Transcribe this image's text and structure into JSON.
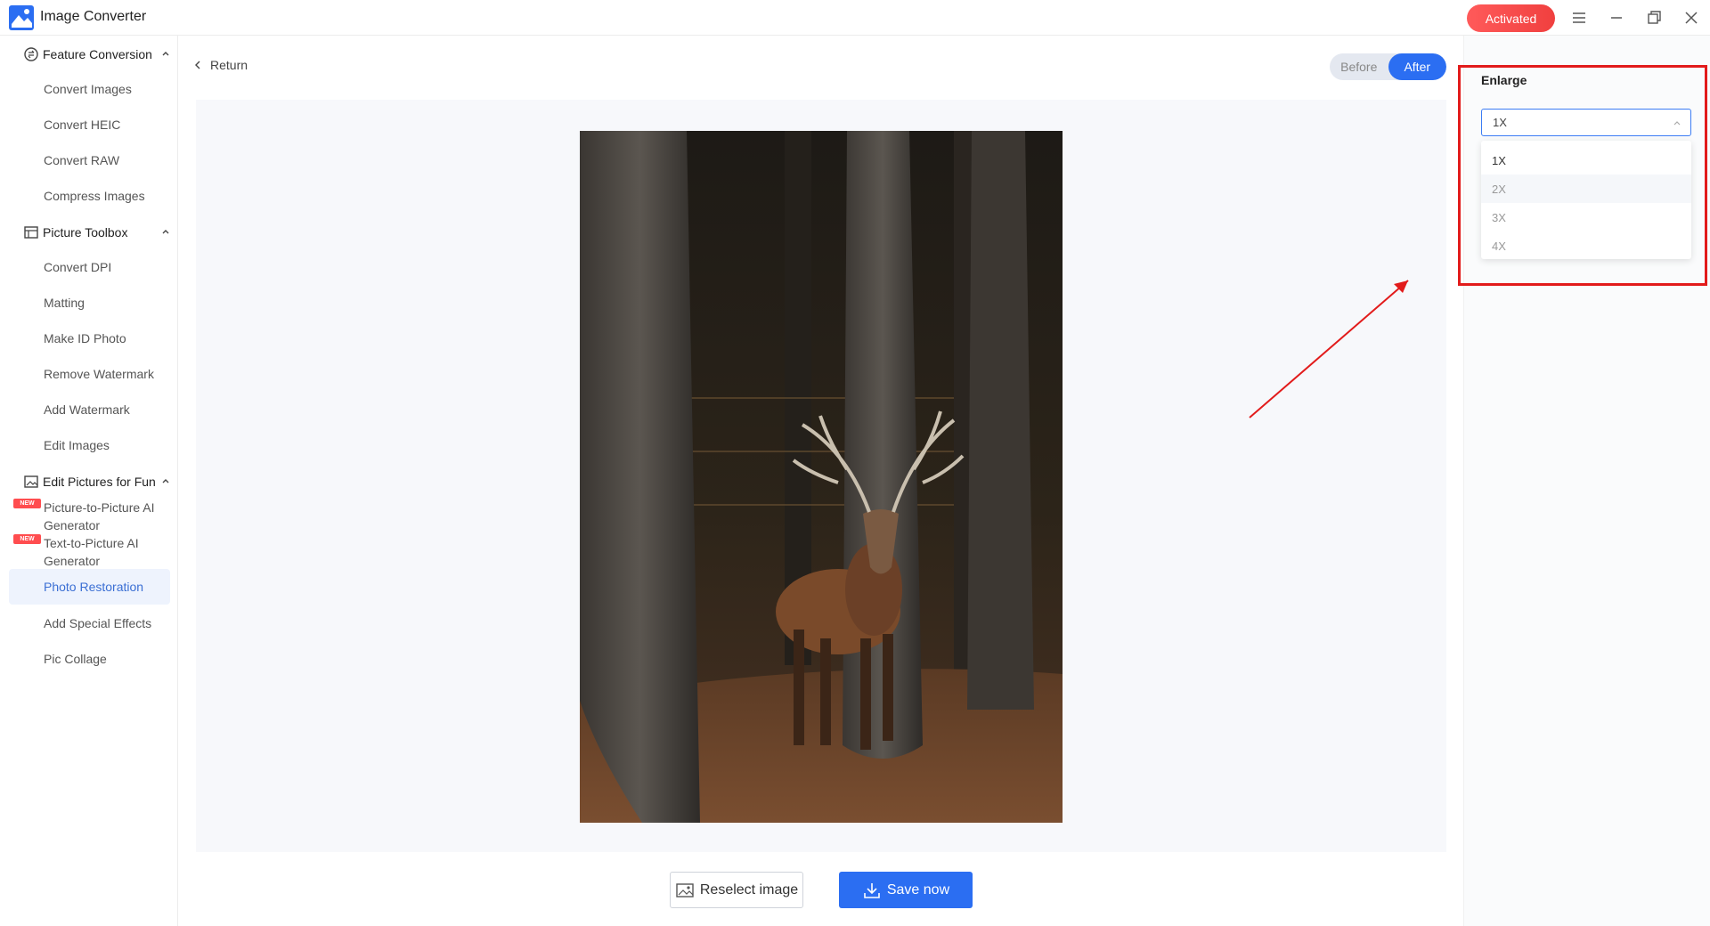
{
  "window": {
    "title": "Image Converter",
    "activated_label": "Activated"
  },
  "sidebar": {
    "groups": [
      {
        "label": "Feature Conversion",
        "items": [
          "Convert Images",
          "Convert HEIC",
          "Convert RAW",
          "Compress Images"
        ]
      },
      {
        "label": "Picture Toolbox",
        "items": [
          "Convert DPI",
          "Matting",
          "Make ID Photo",
          "Remove Watermark",
          "Add Watermark",
          "Edit Images"
        ]
      },
      {
        "label": "Edit Pictures for Fun",
        "items": [
          "Picture-to-Picture AI Generator",
          "Text-to-Picture AI Generator",
          "Photo Restoration",
          "Add Special Effects",
          "Pic Collage"
        ]
      }
    ],
    "new_badge": "NEW",
    "active_item": "Photo Restoration"
  },
  "main": {
    "return_label": "Return",
    "toggle": {
      "before": "Before",
      "after": "After",
      "active": "After"
    },
    "reselect_label": "Reselect image",
    "save_label": "Save now"
  },
  "panel": {
    "enlarge_label": "Enlarge",
    "selected": "1X",
    "options": [
      "1X",
      "2X",
      "3X",
      "4X"
    ],
    "hovered": "2X"
  },
  "colors": {
    "accent": "#2b6ef2",
    "activated": "#f0403f",
    "highlight": "#e21b1b",
    "new_badge": "#ff4d4f"
  },
  "icons": {
    "logo": "image-converter-logo",
    "menu": "menu-icon",
    "minimize": "minimize-icon",
    "restore": "restore-icon",
    "close": "close-icon"
  }
}
